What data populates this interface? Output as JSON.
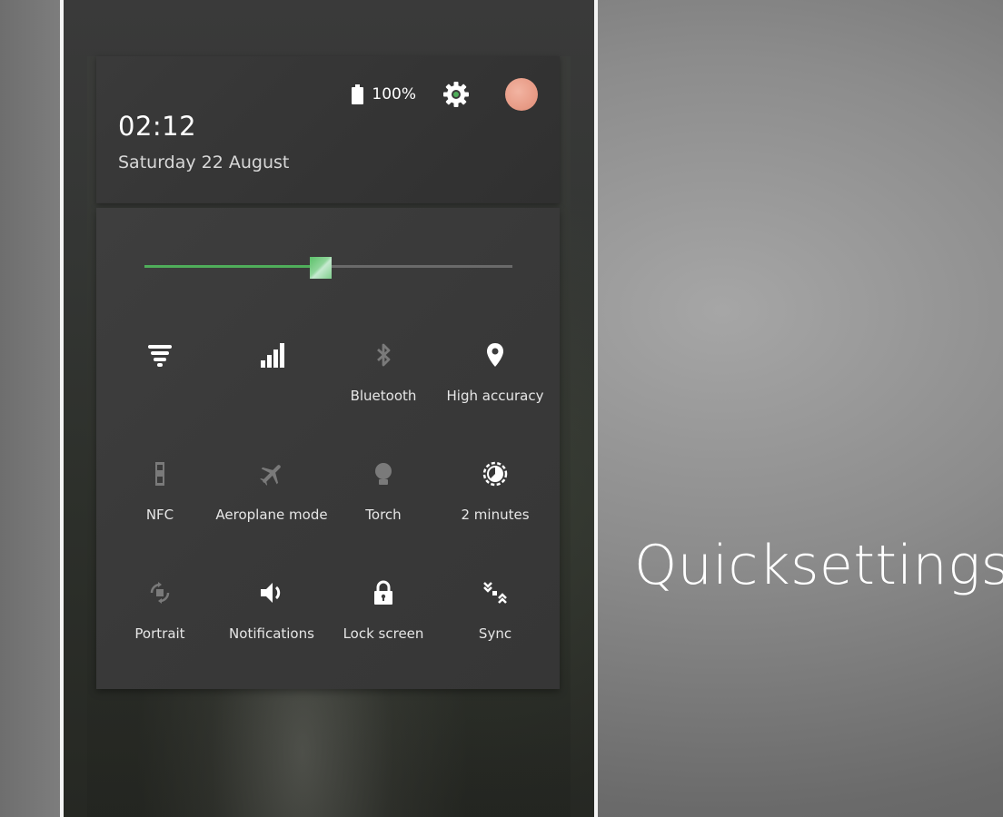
{
  "status": {
    "battery_percent": "100%",
    "time": "02:12",
    "date": "Saturday 22 August"
  },
  "brightness": {
    "level": 0.48,
    "accent_color": "#4fae5a"
  },
  "tiles": [
    {
      "label": "",
      "icon": "wifi-icon",
      "active": true
    },
    {
      "label": "",
      "icon": "signal-icon",
      "active": true
    },
    {
      "label": "Bluetooth",
      "icon": "bluetooth-icon",
      "active": false
    },
    {
      "label": "High accuracy",
      "icon": "location-pin-icon",
      "active": true
    },
    {
      "label": "NFC",
      "icon": "nfc-icon",
      "active": false
    },
    {
      "label": "Aeroplane mode",
      "icon": "airplane-icon",
      "active": false
    },
    {
      "label": "Torch",
      "icon": "torch-icon",
      "active": false
    },
    {
      "label": "2 minutes",
      "icon": "screen-timeout-icon",
      "active": true
    },
    {
      "label": "Portrait",
      "icon": "rotation-icon",
      "active": false
    },
    {
      "label": "Notifications",
      "icon": "speaker-icon",
      "active": true
    },
    {
      "label": "Lock screen",
      "icon": "lock-icon",
      "active": true
    },
    {
      "label": "Sync",
      "icon": "sync-icon",
      "active": true
    }
  ],
  "brand_title": "Quicksettings"
}
